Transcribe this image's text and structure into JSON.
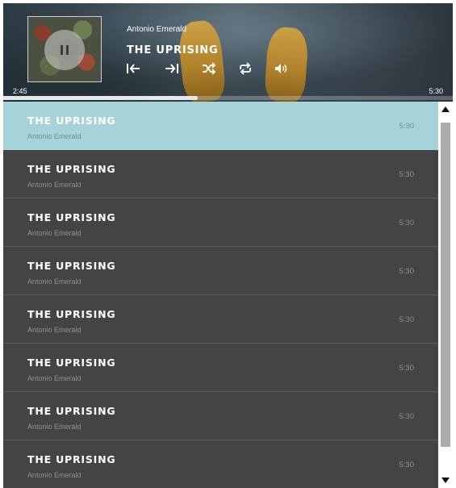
{
  "now_playing": {
    "artist": "Antonio Emerald",
    "title": "THE UPRISING",
    "elapsed": "2:45",
    "duration": "5:30",
    "progress": 0.4333,
    "state": "playing",
    "album_art_icon": "pause-icon"
  },
  "controls": [
    {
      "name": "previous-icon",
      "label": "Previous"
    },
    {
      "name": "next-icon",
      "label": "Next"
    },
    {
      "name": "shuffle-icon",
      "label": "Shuffle"
    },
    {
      "name": "repeat-icon",
      "label": "Repeat"
    },
    {
      "name": "volume-icon",
      "label": "Volume"
    }
  ],
  "playlist": [
    {
      "title": "THE UPRISING",
      "artist": "Antonio Emerald",
      "duration": "5:30",
      "active": true
    },
    {
      "title": "THE UPRISING",
      "artist": "Antonio Emerald",
      "duration": "5:30",
      "active": false
    },
    {
      "title": "THE UPRISING",
      "artist": "Antonio Emerald",
      "duration": "5:30",
      "active": false
    },
    {
      "title": "THE UPRISING",
      "artist": "Antonio Emerald",
      "duration": "5:30",
      "active": false
    },
    {
      "title": "THE UPRISING",
      "artist": "Antonio Emerald",
      "duration": "5:30",
      "active": false
    },
    {
      "title": "THE UPRISING",
      "artist": "Antonio Emerald",
      "duration": "5:30",
      "active": false
    },
    {
      "title": "THE UPRISING",
      "artist": "Antonio Emerald",
      "duration": "5:30",
      "active": false
    },
    {
      "title": "THE UPRISING",
      "artist": "Antonio Emerald",
      "duration": "5:30",
      "active": false
    }
  ],
  "colors": {
    "active_row": "#a6d3d9",
    "list_background": "#444444",
    "scroll_thumb": "#acacac"
  }
}
